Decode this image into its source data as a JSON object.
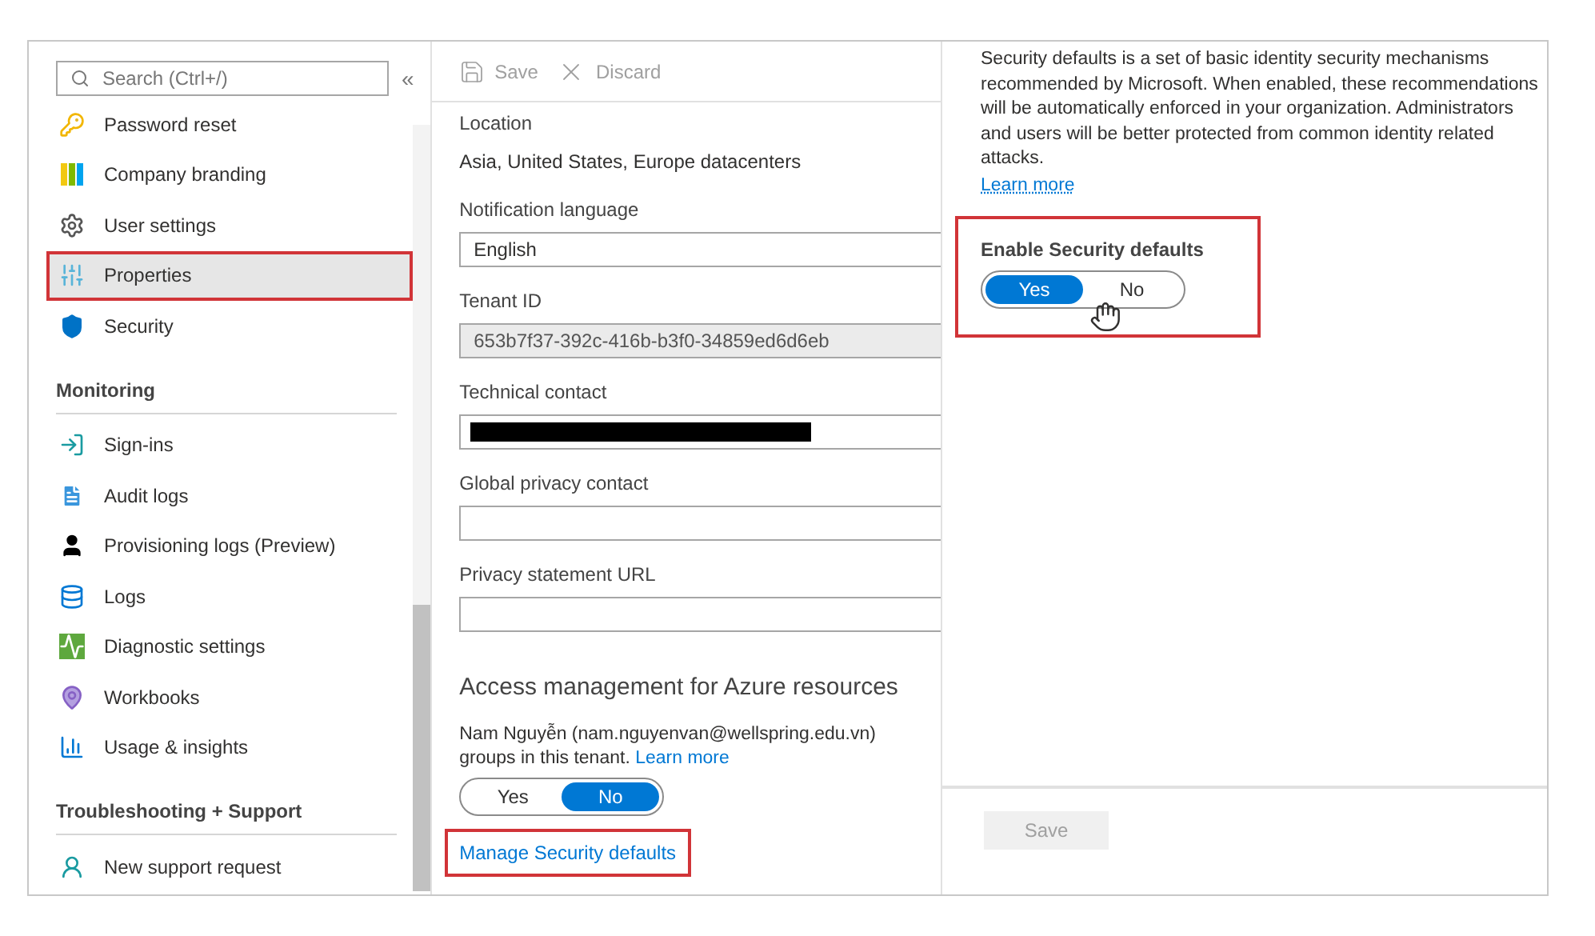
{
  "sidebar": {
    "search": {
      "placeholder": "Search (Ctrl+/)"
    },
    "collapse": "«",
    "items": [
      {
        "kind": "item",
        "label": "Password reset",
        "selected": false,
        "highlighted": false
      },
      {
        "kind": "item",
        "label": "Company branding",
        "selected": false,
        "highlighted": false
      },
      {
        "kind": "item",
        "label": "User settings",
        "selected": false,
        "highlighted": false
      },
      {
        "kind": "item",
        "label": "Properties",
        "selected": true,
        "highlighted": true
      },
      {
        "kind": "item",
        "label": "Security",
        "selected": false,
        "highlighted": false
      },
      {
        "kind": "header",
        "label": "Monitoring"
      },
      {
        "kind": "item",
        "label": "Sign-ins",
        "selected": false,
        "highlighted": false
      },
      {
        "kind": "item",
        "label": "Audit logs",
        "selected": false,
        "highlighted": false
      },
      {
        "kind": "item",
        "label": "Provisioning logs (Preview)",
        "selected": false,
        "highlighted": false
      },
      {
        "kind": "item",
        "label": "Logs",
        "selected": false,
        "highlighted": false
      },
      {
        "kind": "item",
        "label": "Diagnostic settings",
        "selected": false,
        "highlighted": false
      },
      {
        "kind": "item",
        "label": "Workbooks",
        "selected": false,
        "highlighted": false
      },
      {
        "kind": "item",
        "label": "Usage & insights",
        "selected": false,
        "highlighted": false
      },
      {
        "kind": "header",
        "label": "Troubleshooting + Support"
      },
      {
        "kind": "item",
        "label": "New support request",
        "selected": false,
        "highlighted": false
      }
    ]
  },
  "toolbar": [
    {
      "label": "Save",
      "disabled": true
    },
    {
      "label": "Discard",
      "disabled": true
    }
  ],
  "properties": [
    {
      "kind": "text",
      "label": "Location",
      "value": "Asia, United States, Europe datacenters"
    },
    {
      "kind": "field",
      "label": "Notification language",
      "value": "English",
      "readonly": false
    },
    {
      "kind": "field",
      "label": "Tenant ID",
      "value": "653b7f37-392c-416b-b3f0-34859ed6d6eb",
      "readonly": true
    },
    {
      "kind": "redacted",
      "label": "Technical contact"
    },
    {
      "kind": "field",
      "label": "Global privacy contact",
      "readonly": false
    },
    {
      "kind": "field",
      "label": "Privacy statement URL",
      "readonly": false
    }
  ],
  "access": {
    "title": "Access management for Azure resources",
    "line_1": "Nam Nguyễn (nam.nguyenvan@wellspring.edu.vn)",
    "line_2": "groups in this tenant.",
    "link": "Learn more",
    "toggle": [
      {
        "label": "Yes",
        "selected": false
      },
      {
        "label": "No",
        "selected": true
      }
    ]
  },
  "manage_link": {
    "label": "Manage Security defaults",
    "highlighted": true
  },
  "security_defaults": {
    "description": "Security defaults is a set of basic identity security mechanisms recommended by Microsoft. When enabled, these recommendations will be automatically enforced in your organization. Administrators and users will be better protected from common identity related attacks.",
    "link": "Learn more",
    "enable_label": "Enable Security defaults",
    "highlighted": true,
    "toggle": [
      {
        "label": "Yes",
        "selected": true
      },
      {
        "label": "No",
        "selected": false
      }
    ],
    "save": {
      "label": "Save",
      "disabled": true
    }
  }
}
